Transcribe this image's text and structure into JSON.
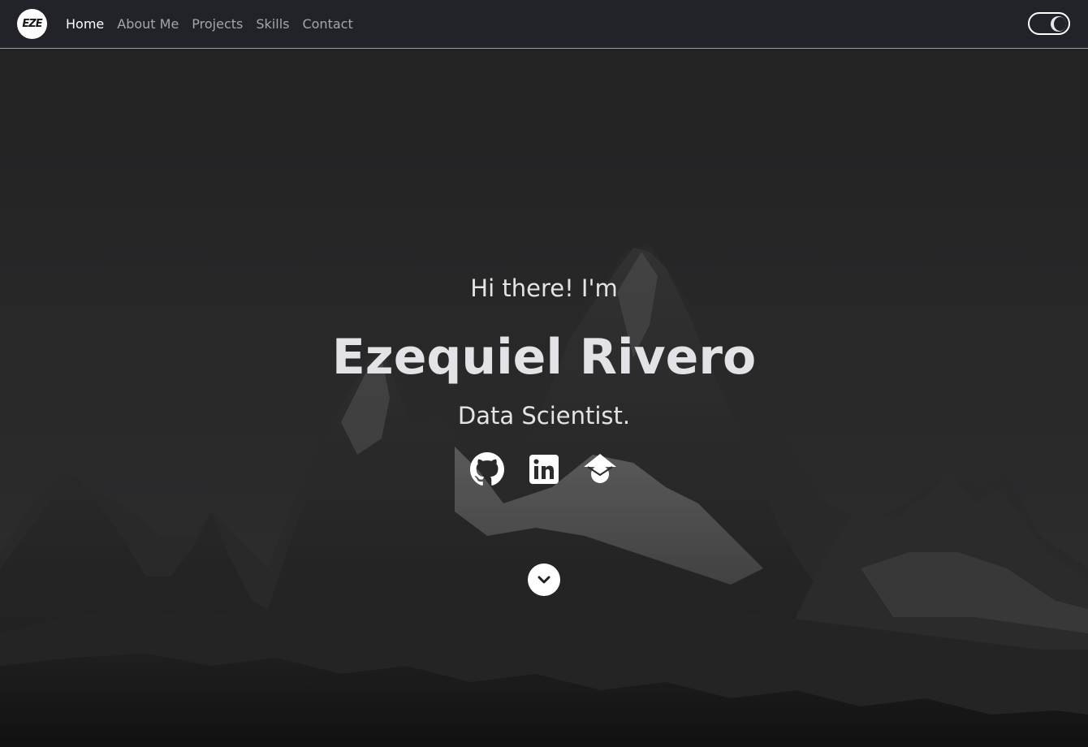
{
  "brand": {
    "logo_text": "EZE"
  },
  "nav": {
    "items": [
      {
        "label": "Home",
        "active": true
      },
      {
        "label": "About Me",
        "active": false
      },
      {
        "label": "Projects",
        "active": false
      },
      {
        "label": "Skills",
        "active": false
      },
      {
        "label": "Contact",
        "active": false
      }
    ],
    "theme_toggle_icon": "moon-icon"
  },
  "hero": {
    "greeting": "Hi there! I'm",
    "name": "Ezequiel Rivero",
    "role": "Data Scientist.",
    "socials": [
      {
        "icon": "github-icon"
      },
      {
        "icon": "linkedin-icon"
      },
      {
        "icon": "graduation-cap-icon"
      }
    ],
    "scroll_icon": "chevron-down-icon"
  },
  "colors": {
    "navbar_bg": "#212328",
    "navbar_border": "#8a9bd1",
    "nav_text": "#a4a6ab",
    "nav_active": "#ffffff",
    "hero_text": "#e4e4e6"
  }
}
